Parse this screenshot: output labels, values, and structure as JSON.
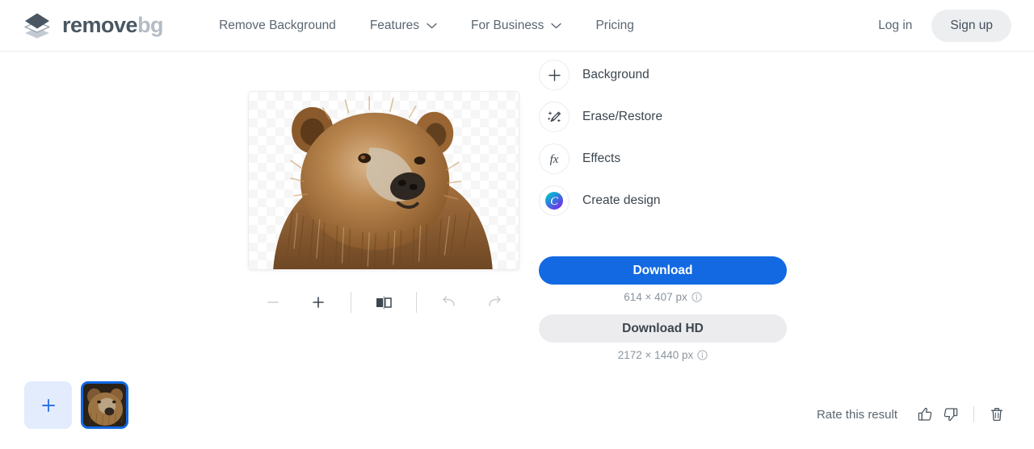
{
  "header": {
    "logo": {
      "icon": "layers-logo-icon",
      "text_primary": "remove",
      "text_secondary": "bg"
    },
    "nav": [
      {
        "label": "Remove Background",
        "has_dropdown": false,
        "icon": ""
      },
      {
        "label": "Features",
        "has_dropdown": true,
        "icon": "chevron-down-icon"
      },
      {
        "label": "For Business",
        "has_dropdown": true,
        "icon": "chevron-down-icon"
      },
      {
        "label": "Pricing",
        "has_dropdown": false,
        "icon": ""
      }
    ],
    "login_label": "Log in",
    "signup_label": "Sign up"
  },
  "editor": {
    "toolbar": {
      "zoom_out": {
        "icon": "minus-icon",
        "enabled": false
      },
      "zoom_in": {
        "icon": "plus-icon",
        "enabled": true
      },
      "compare": {
        "icon": "compare-split-icon",
        "enabled": true
      },
      "undo": {
        "icon": "undo-icon",
        "enabled": false
      },
      "redo": {
        "icon": "redo-icon",
        "enabled": false
      }
    },
    "canvas": {
      "alt": "brown bear head on transparent checkerboard background"
    }
  },
  "panel": {
    "tools": [
      {
        "label": "Background",
        "icon": "plus-icon"
      },
      {
        "label": "Erase/Restore",
        "icon": "magic-brush-icon"
      },
      {
        "label": "Effects",
        "icon": "fx-icon"
      },
      {
        "label": "Create design",
        "icon": "canva-icon"
      }
    ],
    "download": {
      "primary_label": "Download",
      "primary_dims": "614 × 407 px",
      "secondary_label": "Download HD",
      "secondary_dims": "2172 × 1440 px",
      "info_icon": "info-circle-icon"
    }
  },
  "thumbnails": {
    "add_label": "+",
    "add_icon": "plus-icon",
    "items": [
      {
        "alt": "bear thumbnail",
        "selected": true
      }
    ]
  },
  "rate": {
    "label": "Rate this result",
    "thumbs_up_icon": "thumbs-up-icon",
    "thumbs_down_icon": "thumbs-down-icon",
    "delete_icon": "trash-icon"
  },
  "colors": {
    "accent_blue": "#1269E2",
    "text_dark": "#3c464f",
    "text_muted": "#8b949d",
    "logo_gray": "#b4bcc4"
  }
}
